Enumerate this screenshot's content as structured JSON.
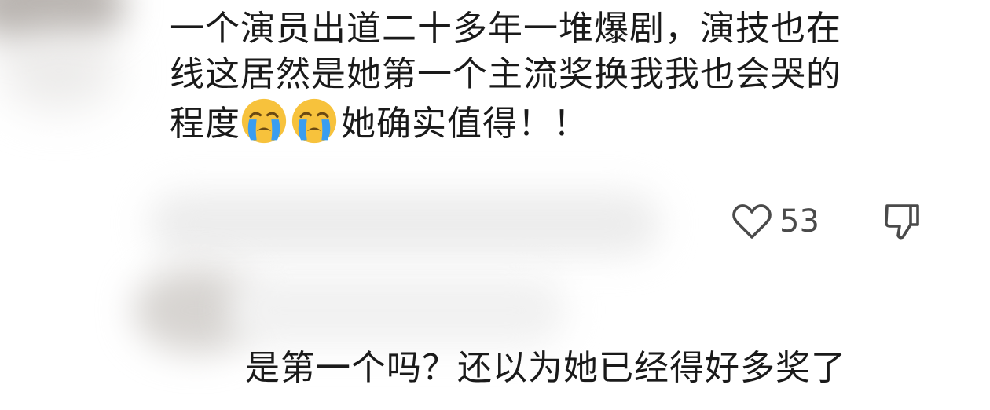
{
  "comment": {
    "line1": "一个演员出道二十多年一堆爆剧，演技也在",
    "line2": "线这居然是她第一个主流奖换我我也会哭的",
    "line3_prefix": "程度",
    "line3_suffix": "她确实值得！！",
    "emojis": [
      "crying-face-emoji",
      "crying-face-emoji"
    ],
    "like_count": "53"
  },
  "reply": {
    "text": "是第一个吗？还以为她已经得好多奖了"
  },
  "icons": {
    "like": "heart-outline-icon",
    "dislike": "thumbs-down-outline-icon"
  },
  "colors": {
    "text": "#1a1a1a",
    "icon": "#4a4a4a",
    "emoji_face": "#f7c23c",
    "emoji_tears": "#3a9df0"
  }
}
